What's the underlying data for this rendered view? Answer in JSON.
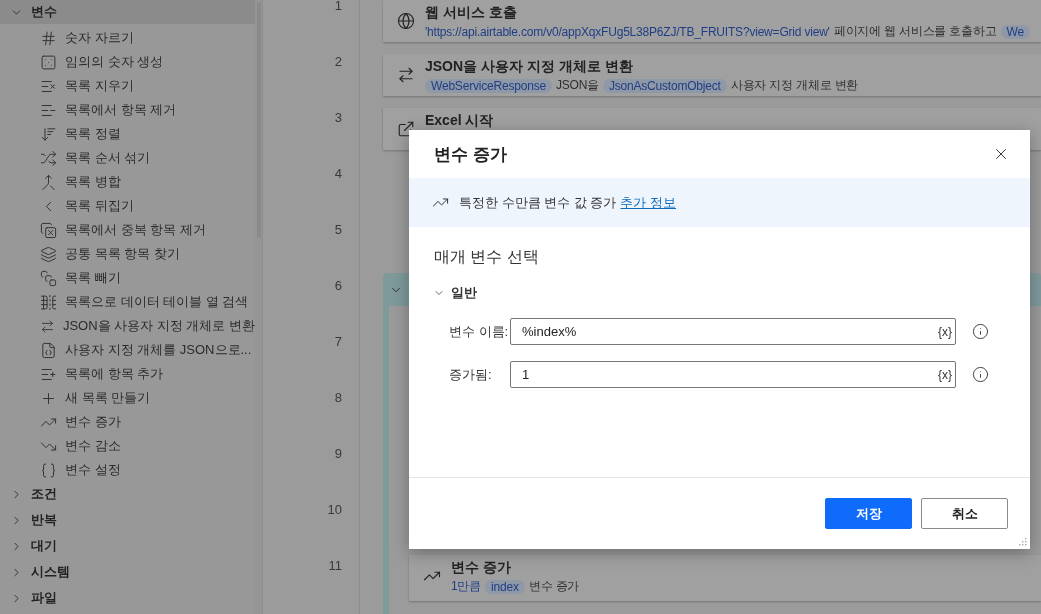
{
  "sidebar": {
    "groups": [
      {
        "label": "변수",
        "expanded": true,
        "selected": true,
        "children": [
          {
            "label": "숫자 자르기"
          },
          {
            "label": "임의의 숫자 생성"
          },
          {
            "label": "목록 지우기"
          },
          {
            "label": "목록에서 항목 제거"
          },
          {
            "label": "목록 정렬"
          },
          {
            "label": "목록 순서 섞기"
          },
          {
            "label": "목록 병합"
          },
          {
            "label": "목록 뒤집기"
          },
          {
            "label": "목록에서 중복 항목 제거"
          },
          {
            "label": "공통 목록 항목 찾기"
          },
          {
            "label": "목록 빼기"
          },
          {
            "label": "목록으로 데이터 테이블 열 검색"
          },
          {
            "label": "JSON을 사용자 지정 개체로 변환"
          },
          {
            "label": "사용자 지정 개체를 JSON으로..."
          },
          {
            "label": "목록에 항목 추가"
          },
          {
            "label": "새 목록 만들기"
          },
          {
            "label": "변수 증가"
          },
          {
            "label": "변수 감소"
          },
          {
            "label": "변수 설정"
          }
        ]
      },
      {
        "label": "조건",
        "expanded": false,
        "selected": false
      },
      {
        "label": "반복",
        "expanded": false,
        "selected": false
      },
      {
        "label": "대기",
        "expanded": false,
        "selected": false
      },
      {
        "label": "시스템",
        "expanded": false,
        "selected": false
      },
      {
        "label": "파일",
        "expanded": false,
        "selected": false
      }
    ]
  },
  "line_numbers": [
    "1",
    "2",
    "3",
    "4",
    "5",
    "6",
    "7",
    "8",
    "9",
    "10",
    "11"
  ],
  "steps": [
    {
      "kind": "action",
      "title": "웹 서비스 호출",
      "parts": [
        {
          "kind": "link",
          "text": "'https://api.airtable.com/v0/appXqxFUg5L38P6ZJ/TB_FRUITS?view=Grid view'"
        },
        {
          "kind": "plain",
          "text": "페이지에 웹 서비스를 호출하고"
        },
        {
          "kind": "chip",
          "text": "We"
        }
      ]
    },
    {
      "kind": "action",
      "title": "JSON을 사용자 지정 개체로 변환",
      "parts": [
        {
          "kind": "chip",
          "text": "WebServiceResponse"
        },
        {
          "kind": "plain",
          "text": "JSON을"
        },
        {
          "kind": "chip",
          "text": "JsonAsCustomObject"
        },
        {
          "kind": "plain",
          "text": "사용자 지정 개체로 변환"
        }
      ]
    },
    {
      "kind": "action",
      "title": "Excel 시작"
    },
    {
      "kind": "group",
      "expanded": true,
      "children": [
        {
          "kind": "action",
          "title": "변수 증가",
          "parts": [
            {
              "kind": "link",
              "text": "1만큼"
            },
            {
              "kind": "chip",
              "text": "index"
            },
            {
              "kind": "plain",
              "text": "변수 증가"
            }
          ]
        }
      ]
    }
  ],
  "dialog": {
    "title": "변수 증가",
    "description": "특정한 수만큼 변수 값 증가",
    "link": "추가 정보",
    "section": "매개 변수 선택",
    "group": {
      "label": "일반",
      "expanded": true
    },
    "fields": [
      {
        "label": "변수 이름:",
        "value": "%index%",
        "token": "{x}"
      },
      {
        "label": "증가됨:",
        "value": "1",
        "token": "{x}"
      }
    ],
    "buttons": [
      {
        "label": "저장",
        "kind": "primary"
      },
      {
        "label": "취소",
        "kind": "secondary"
      }
    ]
  }
}
